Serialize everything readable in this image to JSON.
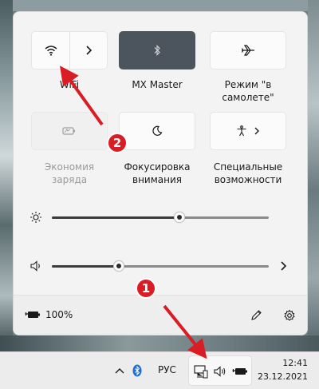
{
  "quick_settings": {
    "tiles": [
      {
        "id": "wifi",
        "label": "WiFi",
        "icon": "wifi-icon",
        "state": "on"
      },
      {
        "id": "bluetooth",
        "label": "MX Master",
        "icon": "bluetooth-icon",
        "state": "active"
      },
      {
        "id": "airplane",
        "label": "Режим \"в самолете\"",
        "label_line1": "Режим \"в",
        "label_line2": "самолете\"",
        "icon": "airplane-icon",
        "state": "off"
      },
      {
        "id": "battery_saver",
        "label_line1": "Экономия",
        "label_line2": "заряда",
        "icon": "battery-saver-icon",
        "state": "disabled"
      },
      {
        "id": "focus",
        "label_line1": "Фокусировка",
        "label_line2": "внимания",
        "icon": "moon-icon",
        "state": "off"
      },
      {
        "id": "accessibility",
        "label_line1": "Специальные",
        "label_line2": "возможности",
        "icon": "accessibility-icon",
        "state": "off"
      }
    ],
    "brightness_percent": 59,
    "volume_percent": 31,
    "battery_text": "100%"
  },
  "taskbar": {
    "language": "РУС",
    "time": "12:41",
    "date": "23.12.2021"
  },
  "annotations": {
    "badge_1": "1",
    "badge_2": "2",
    "color": "#d81d24"
  },
  "colors": {
    "active_tile": "#4c555e",
    "panel_bg": "#f3f3f3"
  }
}
